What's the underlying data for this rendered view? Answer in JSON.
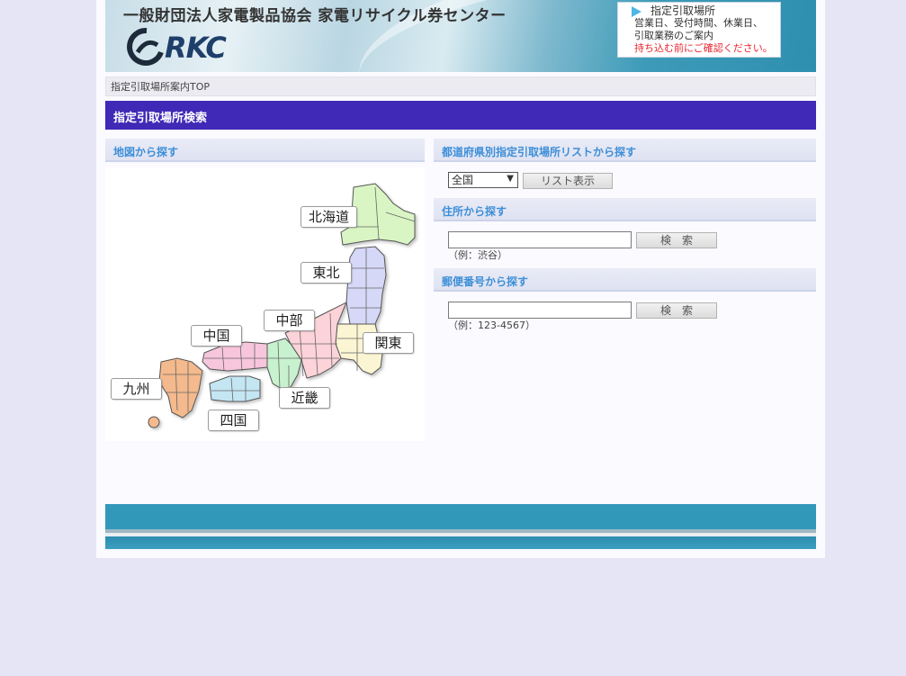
{
  "header": {
    "org_name": "一般財団法人家電製品協会 家電リサイクル券センター",
    "logo_text": "RKC",
    "notice": {
      "title": "指定引取場所",
      "line1": "営業日、受付時間、休業日、",
      "line2": "引取業務のご案内",
      "warning": "持ち込む前にご確認ください。"
    }
  },
  "breadcrumb": "指定引取場所案内TOP",
  "section_title": "指定引取場所検索",
  "map_panel": {
    "title": "地図から探す",
    "regions": {
      "hokkaido": "北海道",
      "tohoku": "東北",
      "chubu": "中部",
      "chugoku": "中国",
      "kanto": "関東",
      "kyushu": "九州",
      "kinki": "近畿",
      "shikoku": "四国"
    }
  },
  "list_panel": {
    "title": "都道府県別指定引取場所リストから探す",
    "select_value": "全国",
    "button": "リスト表示"
  },
  "address_panel": {
    "title": "住所から探す",
    "value": "",
    "hint": "（例：渋谷）",
    "button": "検　索"
  },
  "postal_panel": {
    "title": "郵便番号から探す",
    "value": "",
    "hint": "（例：123-4567）",
    "button": "検　索"
  },
  "colors": {
    "section_bar": "#3f29b6",
    "panel_title": "#3d8fd8",
    "footer": "#3298ba",
    "background": "#e6e5f6"
  }
}
